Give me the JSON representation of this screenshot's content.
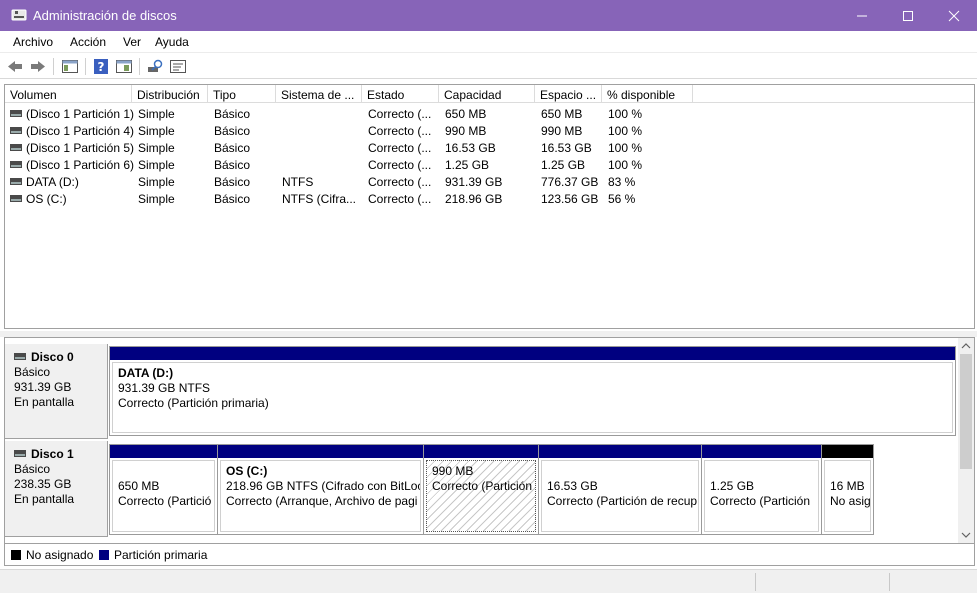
{
  "window": {
    "title": "Administración de discos"
  },
  "menu": [
    "Archivo",
    "Acción",
    "Ver",
    "Ayuda"
  ],
  "toolbar_icons": [
    "back-arrow-icon",
    "forward-arrow-icon",
    "console-tree-icon",
    "help-icon",
    "properties-icon",
    "rescan-icon",
    "settings-icon"
  ],
  "volume_table": {
    "headers": [
      "Volumen",
      "Distribución",
      "Tipo",
      "Sistema de ...",
      "Estado",
      "Capacidad",
      "Espacio ...",
      "% disponible"
    ],
    "rows": [
      [
        "(Disco 1 Partición 1)",
        "Simple",
        "Básico",
        "",
        "Correcto (...",
        "650 MB",
        "650 MB",
        "100 %"
      ],
      [
        "(Disco 1 Partición 4)",
        "Simple",
        "Básico",
        "",
        "Correcto (...",
        "990 MB",
        "990 MB",
        "100 %"
      ],
      [
        "(Disco 1 Partición 5)",
        "Simple",
        "Básico",
        "",
        "Correcto (...",
        "16.53 GB",
        "16.53 GB",
        "100 %"
      ],
      [
        "(Disco 1 Partición 6)",
        "Simple",
        "Básico",
        "",
        "Correcto (...",
        "1.25 GB",
        "1.25 GB",
        "100 %"
      ],
      [
        "DATA (D:)",
        "Simple",
        "Básico",
        "NTFS",
        "Correcto (...",
        "931.39 GB",
        "776.37 GB",
        "83 %"
      ],
      [
        "OS (C:)",
        "Simple",
        "Básico",
        "NTFS (Cifra...",
        "Correcto (...",
        "218.96 GB",
        "123.56 GB",
        "56 %"
      ]
    ]
  },
  "disks": [
    {
      "name": "Disco 0",
      "type": "Básico",
      "size": "931.39 GB",
      "status": "En pantalla",
      "partitions": [
        {
          "title": "DATA  (D:)",
          "line1": "931.39 GB NTFS",
          "line2": "Correcto (Partición primaria)"
        }
      ]
    },
    {
      "name": "Disco 1",
      "type": "Básico",
      "size": "238.35 GB",
      "status": "En pantalla",
      "partitions": [
        {
          "title": "",
          "line1": "650 MB",
          "line2": "Correcto (Partició"
        },
        {
          "title": "OS  (C:)",
          "line1": "218.96 GB NTFS (Cifrado con BitLock",
          "line2": "Correcto (Arranque, Archivo de pagi"
        },
        {
          "title": "",
          "line1": "990 MB",
          "line2": "Correcto (Partición"
        },
        {
          "title": "",
          "line1": "16.53 GB",
          "line2": "Correcto (Partición de recup"
        },
        {
          "title": "",
          "line1": "1.25 GB",
          "line2": "Correcto (Partición"
        },
        {
          "title": "",
          "line1": "16 MB",
          "line2": "No asig"
        }
      ]
    }
  ],
  "legend": [
    "No asignado",
    "Partición primaria"
  ],
  "colors": {
    "titlebar": "#8764b8",
    "primary_partition": "#000080",
    "unallocated": "#000000"
  }
}
